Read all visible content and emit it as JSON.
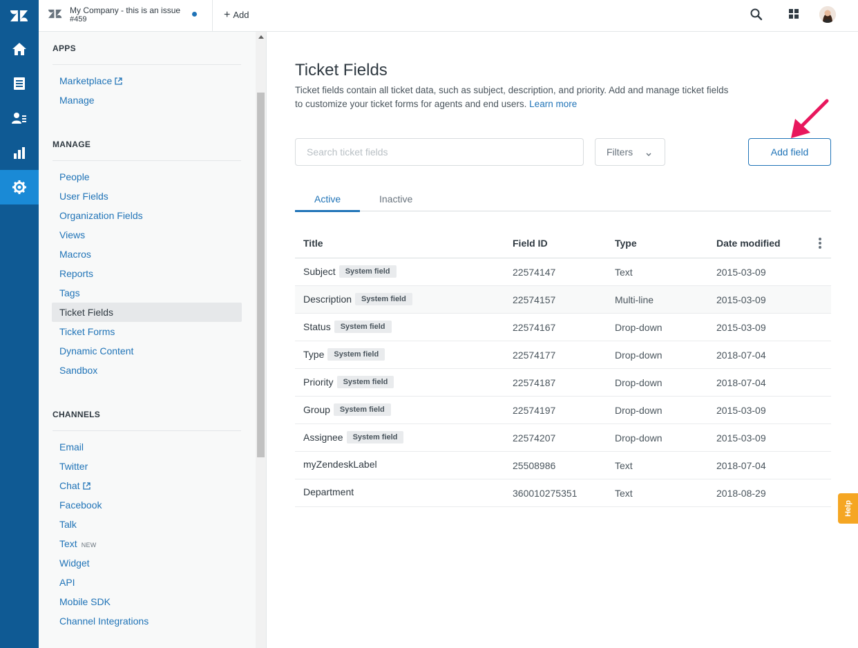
{
  "rail": {
    "items": [
      "home-icon",
      "views-icon",
      "customers-icon",
      "reporting-icon",
      "admin-gear-icon"
    ],
    "active": "admin-gear-icon",
    "color": "#0f5a94"
  },
  "topbar": {
    "tab_title": "My Company - this is an issue",
    "tab_sub": "#459",
    "add_label": "Add"
  },
  "sidebar": {
    "apps_heading": "APPS",
    "apps_items": [
      "Marketplace",
      "Manage"
    ],
    "manage_heading": "MANAGE",
    "manage_items": [
      "People",
      "User Fields",
      "Organization Fields",
      "Views",
      "Macros",
      "Reports",
      "Tags",
      "Ticket Fields",
      "Ticket Forms",
      "Dynamic Content",
      "Sandbox"
    ],
    "channels_heading": "CHANNELS",
    "channels_items": [
      "Email",
      "Twitter",
      "Chat",
      "Facebook",
      "Talk",
      "Text",
      "Widget",
      "API",
      "Mobile SDK",
      "Channel Integrations"
    ],
    "new_label": "NEW",
    "active_item": "Ticket Fields"
  },
  "main": {
    "title": "Ticket Fields",
    "description": "Ticket fields contain all ticket data, such as subject, description, and priority. Add and manage ticket fields to customize your ticket forms for agents and end users.",
    "learn_more": "Learn more",
    "search_placeholder": "Search ticket fields",
    "filters_label": "Filters",
    "add_field_label": "Add field",
    "tabs": [
      "Active",
      "Inactive"
    ],
    "active_tab": "Active"
  },
  "table": {
    "headers": [
      "Title",
      "Field ID",
      "Type",
      "Date modified"
    ],
    "system_badge": "System field",
    "rows": [
      {
        "title": "Subject",
        "system": true,
        "id": "22574147",
        "type": "Text",
        "date": "2015-03-09"
      },
      {
        "title": "Description",
        "system": true,
        "id": "22574157",
        "type": "Multi-line",
        "date": "2015-03-09"
      },
      {
        "title": "Status",
        "system": true,
        "id": "22574167",
        "type": "Drop-down",
        "date": "2015-03-09"
      },
      {
        "title": "Type",
        "system": true,
        "id": "22574177",
        "type": "Drop-down",
        "date": "2018-07-04"
      },
      {
        "title": "Priority",
        "system": true,
        "id": "22574187",
        "type": "Drop-down",
        "date": "2018-07-04"
      },
      {
        "title": "Group",
        "system": true,
        "id": "22574197",
        "type": "Drop-down",
        "date": "2015-03-09"
      },
      {
        "title": "Assignee",
        "system": true,
        "id": "22574207",
        "type": "Drop-down",
        "date": "2015-03-09"
      },
      {
        "title": "myZendeskLabel",
        "system": false,
        "id": "25508986",
        "type": "Text",
        "date": "2018-07-04"
      },
      {
        "title": "Department",
        "system": false,
        "id": "360010275351",
        "type": "Text",
        "date": "2018-08-29"
      }
    ]
  },
  "help": {
    "label": "Help"
  },
  "colors": {
    "accent": "#1f73b7",
    "annotation_arrow": "#e8175d",
    "help_tab": "#f5a623"
  }
}
